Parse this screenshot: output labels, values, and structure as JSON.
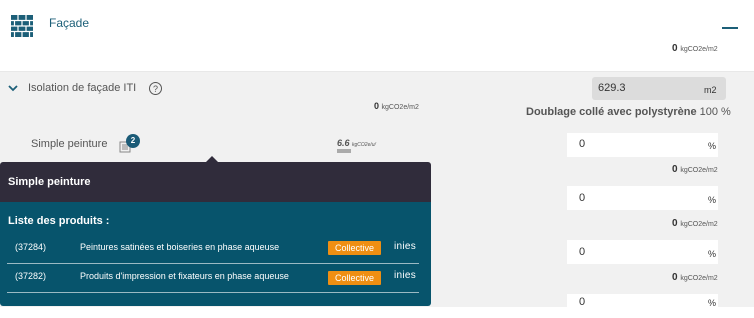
{
  "header": {
    "title": "Façade",
    "total_value": "0",
    "total_unit": "kgCO2e/m2"
  },
  "section": {
    "title": "Isolation de façade ITI",
    "help_symbol": "?",
    "total_value": "0",
    "total_unit": "kgCO2e/m2",
    "area_value": "629.3",
    "area_unit": "m2",
    "material_name": "Doublage collé avec polystyrène",
    "material_percent": "100 %"
  },
  "item": {
    "label": "Simple peinture",
    "badge_count": "2",
    "emission_value": "6.6",
    "emission_unit": "kgCO2e/u/"
  },
  "rows": [
    {
      "value": "0",
      "pct": "%",
      "total_value": "0",
      "total_unit": "kgCO2e/m2"
    },
    {
      "value": "0",
      "pct": "%",
      "total_value": "0",
      "total_unit": "kgCO2e/m2"
    },
    {
      "value": "0",
      "pct": "%",
      "total_value": "0",
      "total_unit": "kgCO2e/m2"
    },
    {
      "value": "0",
      "pct": "%"
    }
  ],
  "popup": {
    "title": "Simple peinture",
    "subtitle": "Liste des produits :",
    "products": [
      {
        "id": "(37284)",
        "name": "Peintures satinées et boiseries en phase aqueuse",
        "tag": "Collective",
        "logo": "inies"
      },
      {
        "id": "(37282)",
        "name": "Produits d'impression et fixateurs en phase aqueuse",
        "tag": "Collective",
        "logo": "inies"
      }
    ]
  },
  "colors": {
    "accent": "#1c5f78",
    "popup_header": "#302c3b",
    "popup_body": "#07546c",
    "tag": "#ef8f13"
  }
}
